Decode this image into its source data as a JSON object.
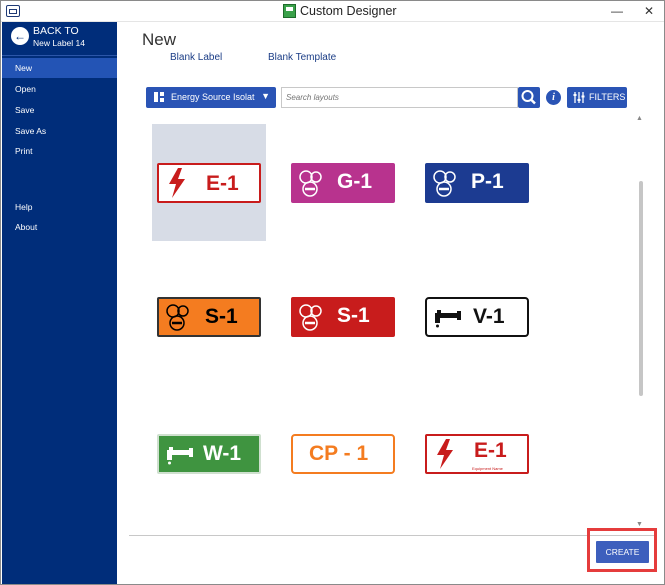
{
  "window": {
    "title": "Custom Designer",
    "minimize": "—",
    "close": "✕"
  },
  "sidebar": {
    "back_title": "BACK TO",
    "back_subtitle": "New Label 14",
    "items": [
      {
        "label": "New",
        "active": true
      },
      {
        "label": "Open"
      },
      {
        "label": "Save"
      },
      {
        "label": "Save As"
      },
      {
        "label": "Print"
      },
      {
        "label": "Help"
      },
      {
        "label": "About"
      }
    ]
  },
  "main": {
    "title": "New",
    "links": [
      "Blank Label",
      "Blank Template"
    ],
    "dropdown_value": "Energy Source Isolat",
    "search_placeholder": "Search layouts",
    "info_label": "i",
    "filters_label": "FILTERS",
    "create_label": "CREATE"
  },
  "layouts": [
    {
      "text": "E-1",
      "bg": "#ffffff",
      "border": "#c81c1c",
      "color": "#c81c1c",
      "icon": "lightning-icon",
      "selected": true
    },
    {
      "text": "G-1",
      "bg": "#b8338e",
      "border": "#b8338e",
      "color": "#ffffff",
      "icon": "gauge-valve-icon"
    },
    {
      "text": "P-1",
      "bg": "#1c3b91",
      "border": "#1c3b91",
      "color": "#ffffff",
      "icon": "gauge-valve-icon"
    },
    {
      "text": "S-1",
      "bg": "#f47c20",
      "border": "#333333",
      "color": "#000000",
      "icon": "gauge-valve-icon"
    },
    {
      "text": "S-1",
      "bg": "#c81c1c",
      "border": "#c81c1c",
      "color": "#ffffff",
      "icon": "gauge-valve-icon"
    },
    {
      "text": "V-1",
      "bg": "#ffffff",
      "border": "#111111",
      "color": "#111111",
      "icon": "faucet-icon"
    },
    {
      "text": "W-1",
      "bg": "#3f9440",
      "border": "#3f9440",
      "color": "#ffffff",
      "icon": "faucet-icon"
    },
    {
      "text": "CP - 1",
      "bg": "#ffffff",
      "border": "#f47c20",
      "color": "#f47c20",
      "icon": ""
    },
    {
      "text": "E-1",
      "bg": "#ffffff",
      "border": "#c81c1c",
      "color": "#c81c1c",
      "icon": "lightning-icon",
      "sub": "Equipment Name"
    }
  ]
}
